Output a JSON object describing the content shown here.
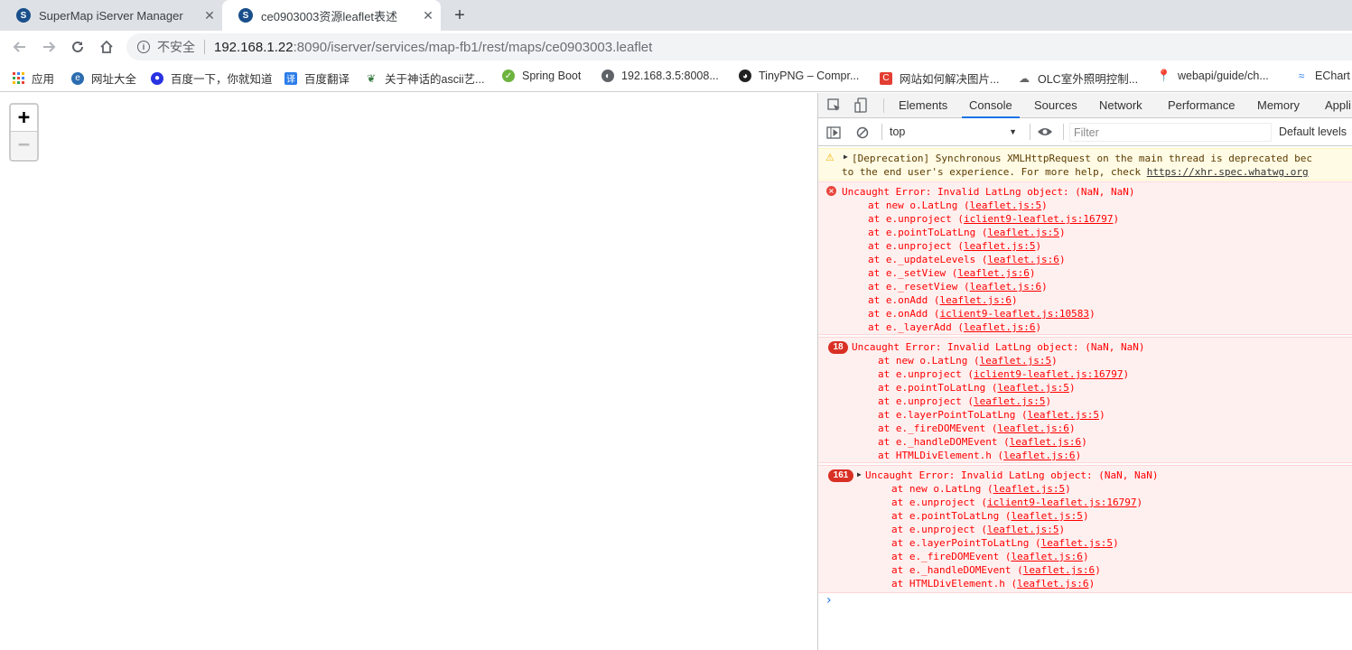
{
  "tabs": [
    {
      "title": "SuperMap iServer Manager"
    },
    {
      "title": "ce0903003资源leaflet表述"
    }
  ],
  "address": {
    "security": "不安全",
    "host": "192.168.1.22",
    "rest": ":8090/iserver/services/map-fb1/rest/maps/ce0903003.leaflet"
  },
  "bookmarks": [
    {
      "label": "应用"
    },
    {
      "label": "网址大全"
    },
    {
      "label": "百度一下，你就知道"
    },
    {
      "label": "百度翻译"
    },
    {
      "label": "关于神话的ascii艺..."
    },
    {
      "label": "Spring Boot"
    },
    {
      "label": "192.168.3.5:8008..."
    },
    {
      "label": "TinyPNG – Compr..."
    },
    {
      "label": "网站如何解决图片..."
    },
    {
      "label": "OLC室外照明控制..."
    },
    {
      "label": "webapi/guide/ch..."
    },
    {
      "label": "EChart"
    }
  ],
  "map": {
    "zoom_in": "+",
    "zoom_out": "−"
  },
  "devtools": {
    "tabs": [
      "Elements",
      "Console",
      "Sources",
      "Network",
      "Performance",
      "Memory",
      "Appli"
    ],
    "context": "top",
    "filter_placeholder": "Filter",
    "levels": "Default levels"
  },
  "console": {
    "warning": {
      "line1": "[Deprecation] Synchronous XMLHttpRequest on the main thread is deprecated bec",
      "line2a": "to the end user's experience. For more help, check ",
      "line2b": "https://xhr.spec.whatwg.org"
    },
    "errors": [
      {
        "count": "",
        "title": "Uncaught Error: Invalid LatLng object: (NaN, NaN)",
        "stack": [
          [
            "at new o.LatLng (",
            "leaflet.js:5",
            ")"
          ],
          [
            "at e.unproject (",
            "iclient9-leaflet.js:16797",
            ")"
          ],
          [
            "at e.pointToLatLng (",
            "leaflet.js:5",
            ")"
          ],
          [
            "at e.unproject (",
            "leaflet.js:5",
            ")"
          ],
          [
            "at e._updateLevels (",
            "leaflet.js:6",
            ")"
          ],
          [
            "at e._setView (",
            "leaflet.js:6",
            ")"
          ],
          [
            "at e._resetView (",
            "leaflet.js:6",
            ")"
          ],
          [
            "at e.onAdd (",
            "leaflet.js:6",
            ")"
          ],
          [
            "at e.onAdd (",
            "iclient9-leaflet.js:10583",
            ")"
          ],
          [
            "at e._layerAdd (",
            "leaflet.js:6",
            ")"
          ]
        ]
      },
      {
        "count": "18",
        "title": "Uncaught Error: Invalid LatLng object: (NaN, NaN)",
        "stack": [
          [
            "at new o.LatLng (",
            "leaflet.js:5",
            ")"
          ],
          [
            "at e.unproject (",
            "iclient9-leaflet.js:16797",
            ")"
          ],
          [
            "at e.pointToLatLng (",
            "leaflet.js:5",
            ")"
          ],
          [
            "at e.unproject (",
            "leaflet.js:5",
            ")"
          ],
          [
            "at e.layerPointToLatLng (",
            "leaflet.js:5",
            ")"
          ],
          [
            "at e._fireDOMEvent (",
            "leaflet.js:6",
            ")"
          ],
          [
            "at e._handleDOMEvent (",
            "leaflet.js:6",
            ")"
          ],
          [
            "at HTMLDivElement.h (",
            "leaflet.js:6",
            ")"
          ]
        ]
      },
      {
        "count": "161",
        "title": "Uncaught Error: Invalid LatLng object: (NaN, NaN)",
        "stack": [
          [
            "at new o.LatLng (",
            "leaflet.js:5",
            ")"
          ],
          [
            "at e.unproject (",
            "iclient9-leaflet.js:16797",
            ")"
          ],
          [
            "at e.pointToLatLng (",
            "leaflet.js:5",
            ")"
          ],
          [
            "at e.unproject (",
            "leaflet.js:5",
            ")"
          ],
          [
            "at e.layerPointToLatLng (",
            "leaflet.js:5",
            ")"
          ],
          [
            "at e._fireDOMEvent (",
            "leaflet.js:6",
            ")"
          ],
          [
            "at e._handleDOMEvent (",
            "leaflet.js:6",
            ")"
          ],
          [
            "at HTMLDivElement.h (",
            "leaflet.js:6",
            ")"
          ]
        ]
      }
    ],
    "prompt": "›"
  }
}
